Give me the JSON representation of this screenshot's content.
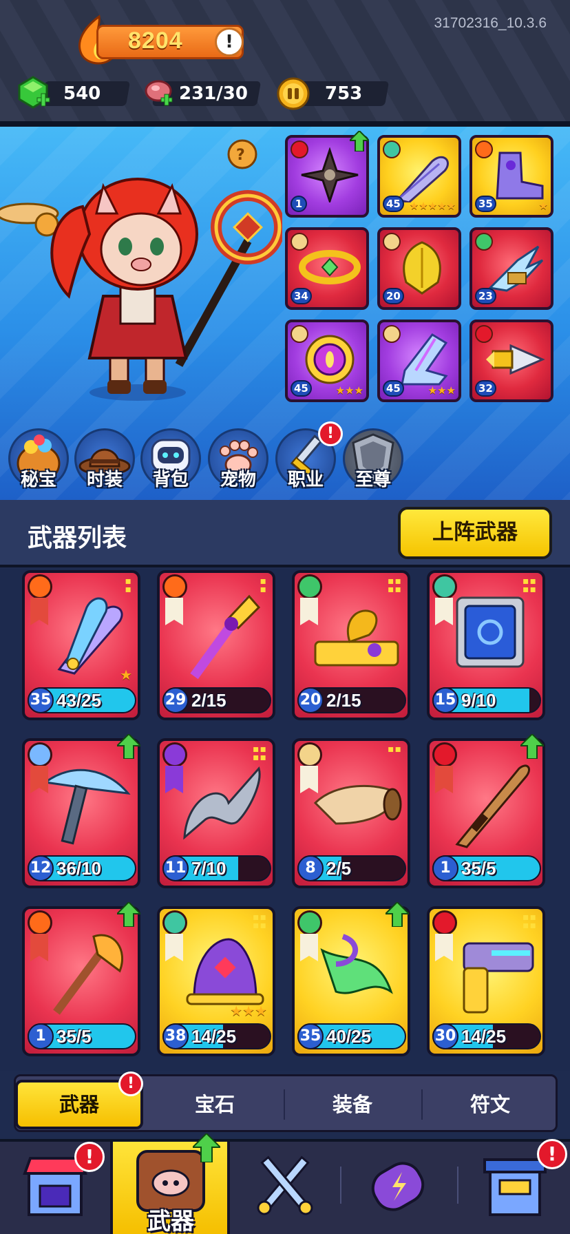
{
  "version": "31702316_10.3.6",
  "resources": {
    "gems": "540",
    "stamina": "231/30",
    "coins": "753"
  },
  "hero": {
    "power": "8204",
    "equipment": [
      {
        "level": "1",
        "stars": "",
        "rarity": "purple"
      },
      {
        "level": "45",
        "stars": "★★★★★",
        "rarity": "gold"
      },
      {
        "level": "35",
        "stars": "★",
        "rarity": "gold"
      },
      {
        "level": "34",
        "stars": "",
        "rarity": "red"
      },
      {
        "level": "20",
        "stars": "",
        "rarity": "red"
      },
      {
        "level": "23",
        "stars": "",
        "rarity": "red"
      },
      {
        "level": "45",
        "stars": "★★★",
        "rarity": "purple"
      },
      {
        "level": "45",
        "stars": "★★★",
        "rarity": "purple"
      },
      {
        "level": "32",
        "stars": "",
        "rarity": "red"
      }
    ]
  },
  "features": [
    "秘宝",
    "时装",
    "背包",
    "宠物",
    "职业",
    "至尊"
  ],
  "list": {
    "title": "武器列表",
    "equip_button": "上阵武器"
  },
  "weapons": [
    {
      "level": "35",
      "progress": "43/25",
      "fill": 1.0,
      "rarity": "red",
      "stars": "★"
    },
    {
      "level": "29",
      "progress": "2/15",
      "fill": 0.13,
      "rarity": "red",
      "stars": ""
    },
    {
      "level": "20",
      "progress": "2/15",
      "fill": 0.13,
      "rarity": "red",
      "stars": ""
    },
    {
      "level": "15",
      "progress": "9/10",
      "fill": 0.9,
      "rarity": "red",
      "stars": ""
    },
    {
      "level": "12",
      "progress": "36/10",
      "fill": 1.0,
      "rarity": "red",
      "stars": ""
    },
    {
      "level": "11",
      "progress": "7/10",
      "fill": 0.7,
      "rarity": "red",
      "stars": ""
    },
    {
      "level": "8",
      "progress": "2/5",
      "fill": 0.4,
      "rarity": "red",
      "stars": ""
    },
    {
      "level": "1",
      "progress": "35/5",
      "fill": 1.0,
      "rarity": "red",
      "stars": ""
    },
    {
      "level": "1",
      "progress": "35/5",
      "fill": 1.0,
      "rarity": "red",
      "stars": ""
    },
    {
      "level": "38",
      "progress": "14/25",
      "fill": 0.56,
      "rarity": "gold",
      "stars": "★★★"
    },
    {
      "level": "35",
      "progress": "40/25",
      "fill": 1.0,
      "rarity": "gold",
      "stars": ""
    },
    {
      "level": "30",
      "progress": "14/25",
      "fill": 0.56,
      "rarity": "gold",
      "stars": ""
    }
  ],
  "category_tabs": [
    "武器",
    "宝石",
    "装备",
    "符文"
  ],
  "bottom_nav": {
    "active_label": "武器"
  },
  "colors": {
    "accent": "#f6c400",
    "alert": "#e3192b",
    "progress": "#21c6ec"
  }
}
